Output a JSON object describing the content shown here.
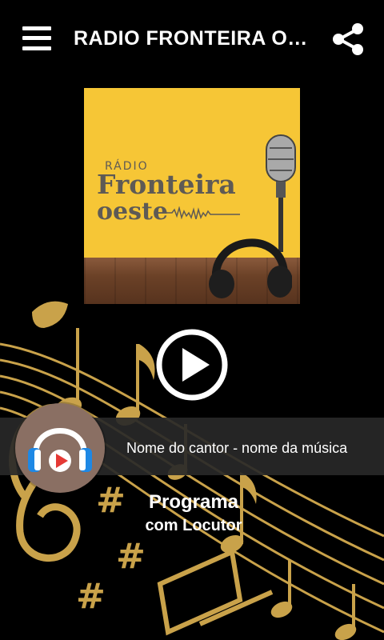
{
  "header": {
    "title": "RADIO FRONTEIRA OESTE",
    "menu_icon": "hamburger-menu-icon",
    "share_icon": "share-icon"
  },
  "cover": {
    "line1": "RÁDIO",
    "line2": "Fronteira",
    "line3": "oeste",
    "background": "#f6c636"
  },
  "player": {
    "play_icon": "play-icon",
    "now_playing": "Nome do cantor - nome da música",
    "program": "Programa",
    "host": "com Locutor"
  },
  "colors": {
    "background": "#000000",
    "accent_gold": "#c9a24a",
    "bar": "#282828"
  }
}
